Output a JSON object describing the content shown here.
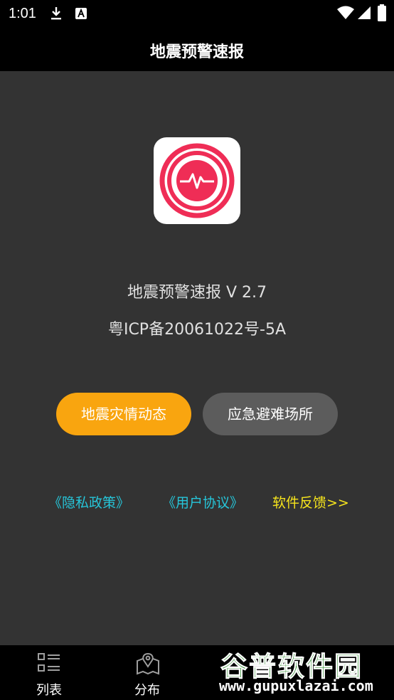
{
  "status_bar": {
    "time": "1:01",
    "icons": [
      "download-icon",
      "a-icon",
      "wifi-icon",
      "signal-icon",
      "battery-icon"
    ]
  },
  "app_bar": {
    "title": "地震预警速报"
  },
  "about": {
    "app_name": "地震预警速报  V 2.7",
    "icp": "粤ICP备20061022号-5A"
  },
  "buttons": {
    "disaster_label": "地震灾情动态",
    "shelter_label": "应急避难场所"
  },
  "links": {
    "privacy": "《隐私政策》",
    "agreement": "《用户协议》",
    "feedback": "软件反馈>>"
  },
  "bottom_nav": {
    "items": [
      {
        "label": "列表",
        "icon": "list-icon"
      },
      {
        "label": "分布",
        "icon": "map-icon"
      }
    ]
  },
  "watermark": {
    "text": "谷普软件园",
    "url": "www.gupuxlazai.com"
  },
  "colors": {
    "accent_orange": "#f9a50f",
    "link_cyan": "#26c6da",
    "link_yellow": "#f7e51c",
    "icon_red": "#ef2d56"
  }
}
